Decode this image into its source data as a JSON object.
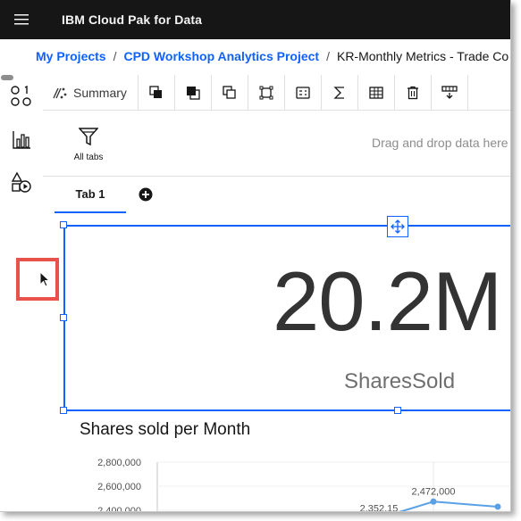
{
  "header": {
    "app_title": "IBM Cloud Pak for Data"
  },
  "breadcrumb": {
    "items": [
      "My Projects",
      "CPD Workshop Analytics Project"
    ],
    "current": "KR-Monthly Metrics - Trade Co",
    "separator": "/"
  },
  "toolbar": {
    "summary_label": "Summary",
    "icons": [
      "copy-icon",
      "bring-forward-icon",
      "duplicate-icon",
      "frame-icon",
      "calculation-icon",
      "summation-icon",
      "table-icon",
      "delete-icon",
      "filter-columns-icon"
    ]
  },
  "filters": {
    "all_tabs_label": "All tabs",
    "drag_hint": "Drag and drop data here"
  },
  "tabs": [
    {
      "label": "Tab 1",
      "selected": true
    }
  ],
  "kpi": {
    "value": "20.2M",
    "label": "SharesSold"
  },
  "chart_data": {
    "type": "line",
    "title": "Shares sold per Month",
    "y_ticks": [
      "2,800,000",
      "2,600,000",
      "2,400,000"
    ],
    "ylim": [
      2400000,
      2800000
    ],
    "data_labels": [
      "2,352,15",
      "2,472,000"
    ],
    "series": [
      {
        "values": [
          2352150,
          2472000,
          2430000
        ]
      }
    ],
    "grid": true
  },
  "colors": {
    "accent": "#0f62fe",
    "header_bg": "#161616",
    "highlight": "#e8524a",
    "line": "#5aa0e6"
  }
}
